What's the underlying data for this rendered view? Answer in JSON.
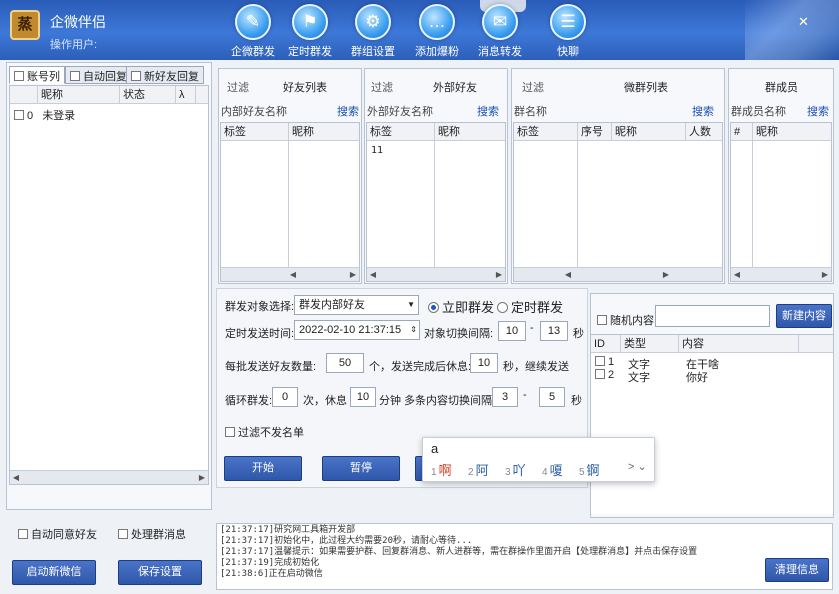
{
  "app": {
    "title": "企微伴侣",
    "subtitle": "操作用户:",
    "logo_text": "蒸"
  },
  "toolbar": [
    {
      "label": "企微群发",
      "icon": "pen-icon",
      "glyph": "✎"
    },
    {
      "label": "定时群发",
      "icon": "user-flag-icon",
      "glyph": "⚑"
    },
    {
      "label": "群组设置",
      "icon": "gear-icon",
      "glyph": "⚙"
    },
    {
      "label": "添加爆粉",
      "icon": "chat-bubble-icon",
      "glyph": "…"
    },
    {
      "label": "消息转发",
      "icon": "message-forward-icon",
      "glyph": "✉"
    },
    {
      "label": "快聊",
      "icon": "quick-chat-icon",
      "glyph": "☰"
    }
  ],
  "left": {
    "tabs": [
      "账号列",
      "自动回复",
      "新好友回复"
    ],
    "columns": [
      "昵称",
      "状态",
      "λ"
    ],
    "rows": [
      {
        "index": "0",
        "name": "未登录"
      }
    ],
    "auto_agree": "自动同意好友",
    "process_group": "处理群消息",
    "start_btn": "启动新微信",
    "save_btn": "保存设置"
  },
  "panels": {
    "friends": {
      "filter": "过滤",
      "title": "好友列表",
      "sub": "内部好友名称",
      "search": "搜索",
      "col1": "标签",
      "col2": "昵称"
    },
    "external": {
      "filter": "过滤",
      "title": "外部好友",
      "sub": "外部好友名称",
      "search": "搜索",
      "col1": "标签",
      "col2": "昵称",
      "first_row": "11"
    },
    "groups": {
      "filter": "过滤",
      "title": "微群列表",
      "sub": "群名称",
      "search": "搜索",
      "col1": "标签",
      "col2": "序号",
      "col3": "昵称",
      "col4": "人数"
    },
    "members": {
      "title": "群成员",
      "sub": "群成员名称",
      "search": "搜索",
      "col1": "#",
      "col2": "昵称"
    }
  },
  "form": {
    "target_label": "群发对象选择:",
    "target_value": "群发内部好友",
    "now_label": "立即群发",
    "timed_label": "定时群发",
    "time_label": "定时发送时间:",
    "time_value": "2022-02-10 21:37:15",
    "switch_label": "对象切换间隔:",
    "switch_min": "10",
    "dash": "-",
    "switch_max": "13",
    "sec": "秒",
    "batch_label": "每批发送好友数量:",
    "batch_value": "50",
    "batch_mid": "个，发送完成后休息:",
    "rest_value": "10",
    "batch_tail": "秒，继续发送",
    "loop_label": "循环群发:",
    "loop_value": "0",
    "loop_mid": "次，休息",
    "loop_rest": "10",
    "loop_tail": "分钟 多条内容切换间隔:",
    "multi_min": "3",
    "multi_max": "5",
    "filter_label": "过滤不发名单",
    "start_btn": "开始",
    "pause_btn": "暂停"
  },
  "content": {
    "random_label": "随机内容",
    "new_btn": "新建内容",
    "col_id": "ID",
    "col_type": "类型",
    "col_content": "内容",
    "rows": [
      {
        "id": "1",
        "type": "文字",
        "content": "在干啥"
      },
      {
        "id": "2",
        "type": "文字",
        "content": "你好"
      }
    ]
  },
  "log": {
    "lines": [
      "[21:37:17]研究网工具箱开发部",
      "[21:37:17]初始化中，此过程大约需要20秒，请耐心等待...",
      "[21:37:17]温馨提示：如果需要护群、回复群消息、新人进群等，需在群操作里面开启【处理群消息】并点击保存设置",
      "[21:37:19]完成初始化",
      "[21:38:6]正在启动微信"
    ],
    "clear_btn": "清理信息"
  },
  "ime": {
    "input": "a",
    "candidates": [
      {
        "n": "1",
        "t": "啊"
      },
      {
        "n": "2",
        "t": "阿"
      },
      {
        "n": "3",
        "t": "吖"
      },
      {
        "n": "4",
        "t": "嗄"
      },
      {
        "n": "5",
        "t": "锕"
      }
    ],
    "more": "> ⌄"
  },
  "colors": {
    "header": "#2f66c4",
    "button": "#3a63b8",
    "link": "#1a4fb5"
  }
}
